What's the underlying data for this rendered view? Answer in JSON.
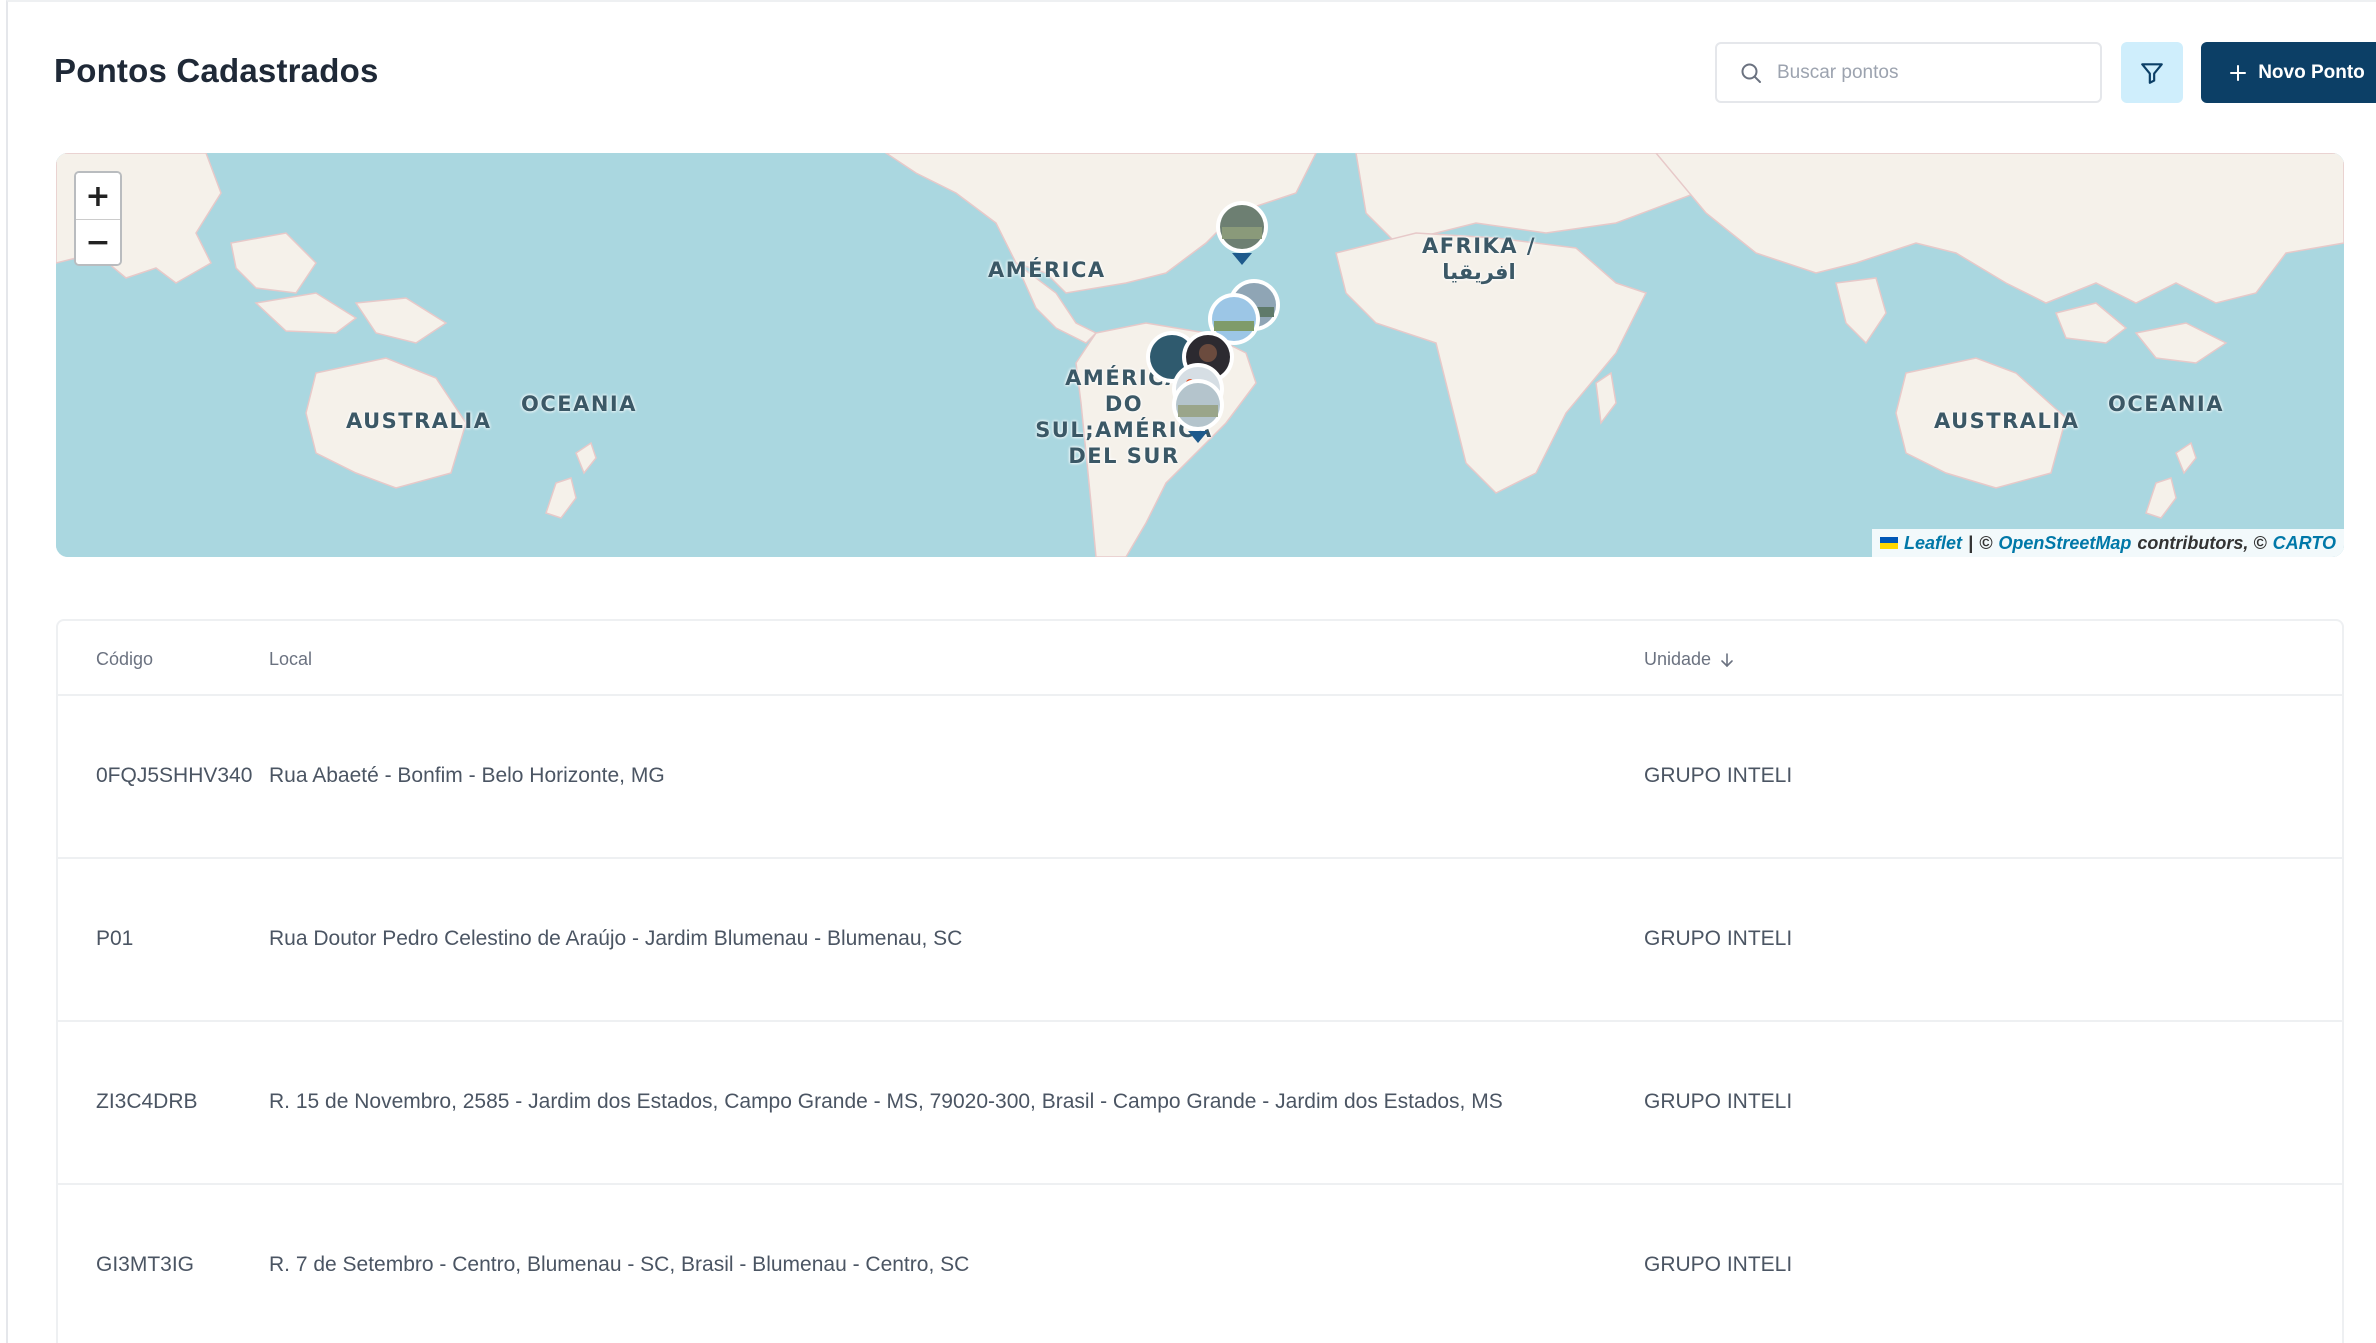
{
  "header": {
    "title": "Pontos Cadastrados",
    "search_placeholder": "Buscar pontos",
    "search_value": "",
    "new_button_label": "Novo Ponto"
  },
  "map": {
    "zoom_in_label": "+",
    "zoom_out_label": "−",
    "labels": {
      "australia_left": "AUSTRALIA",
      "oceania_left": "OCEANIA",
      "america": "AMÉRICA",
      "south_america": "AMÉRICA\nDO SUL;AMÉRICA\nDEL SUR",
      "afrika": "AFRIKA /\nافريقيا",
      "australia_right": "AUSTRALIA",
      "oceania_right": "OCEANIA"
    },
    "attribution": {
      "leaflet": "Leaflet",
      "separator": "|",
      "osm_prefix": "©",
      "osm": "OpenStreetMap",
      "contributors": "contributors, ©",
      "carto": "CARTO"
    }
  },
  "table": {
    "columns": {
      "code": "Código",
      "local": "Local",
      "unit": "Unidade"
    },
    "rows": [
      {
        "code": "0FQJ5SHHV340",
        "local": "Rua Abaeté - Bonfim - Belo Horizonte, MG",
        "unit": "GRUPO INTELI"
      },
      {
        "code": "P01",
        "local": "Rua Doutor Pedro Celestino de Araújo - Jardim Blumenau - Blumenau, SC",
        "unit": "GRUPO INTELI"
      },
      {
        "code": "ZI3C4DRB",
        "local": "R. 15 de Novembro, 2585 - Jardim dos Estados, Campo Grande - MS, 79020-300, Brasil - Campo Grande - Jardim dos Estados, MS",
        "unit": "GRUPO INTELI"
      },
      {
        "code": "GI3MT3IG",
        "local": "R. 7 de Setembro - Centro, Blumenau - SC, Brasil - Blumenau - Centro, SC",
        "unit": "GRUPO INTELI"
      }
    ]
  },
  "colors": {
    "primary": "#0c3f66",
    "filter_bg": "#cfeefc",
    "ocean": "#aad7e0",
    "land": "#f5f1ea",
    "link": "#0078a8"
  }
}
